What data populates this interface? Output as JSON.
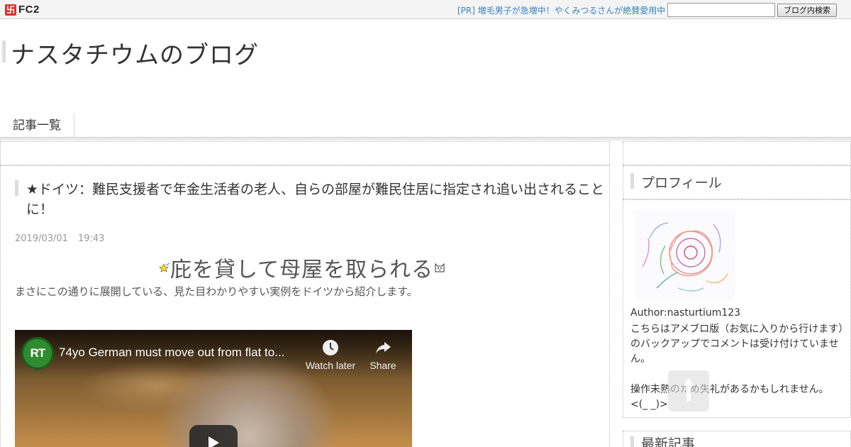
{
  "fc2_bar": {
    "logo_text": "FC2",
    "pr_link": "[PR] 増毛男子が急増中！やくみつるさんが絶賛愛用中",
    "search_value": "",
    "search_button": "ブログ内検索"
  },
  "blog": {
    "title": "ナスタチウムのブログ"
  },
  "nav": {
    "items": [
      {
        "label": "記事一覧"
      }
    ]
  },
  "entry": {
    "title": "★ドイツ：難民支援者で年金生活者の老人、自らの部屋が難民住居に指定され追い出されることに！",
    "date": "2019/03/01",
    "time": "19:43",
    "headline": "庇を貸して母屋を取られる",
    "intro": "まさにこの通りに展開している、見た目わかりやすい実例をドイツから紹介します。"
  },
  "video": {
    "channel_logo": "RT",
    "title": "74yo German must move out from flat to...",
    "watch_later": "Watch later",
    "share": "Share"
  },
  "sidebar": {
    "profile_heading": "プロフィール",
    "author": "Author:nasturtium123",
    "description": "こちらはアメブロ版（お気に入りから行けます）のバックアップでコメントは受け付けていません。",
    "note_line1": "操作未熟のため失礼があるかもしれません。",
    "note_line2": "<(_ _)>",
    "recent_heading": "最新記事"
  },
  "icons": {
    "headline_left": "shooting-star-icon",
    "headline_right": "cat-face-icon",
    "watch_later": "clock-icon",
    "share": "share-arrow-icon",
    "play": "play-icon",
    "to_top": "arrow-up-icon"
  },
  "colors": {
    "pr_link": "#3a82c4",
    "rt_green": "#2e8b2e",
    "border": "#b9b9b9"
  }
}
